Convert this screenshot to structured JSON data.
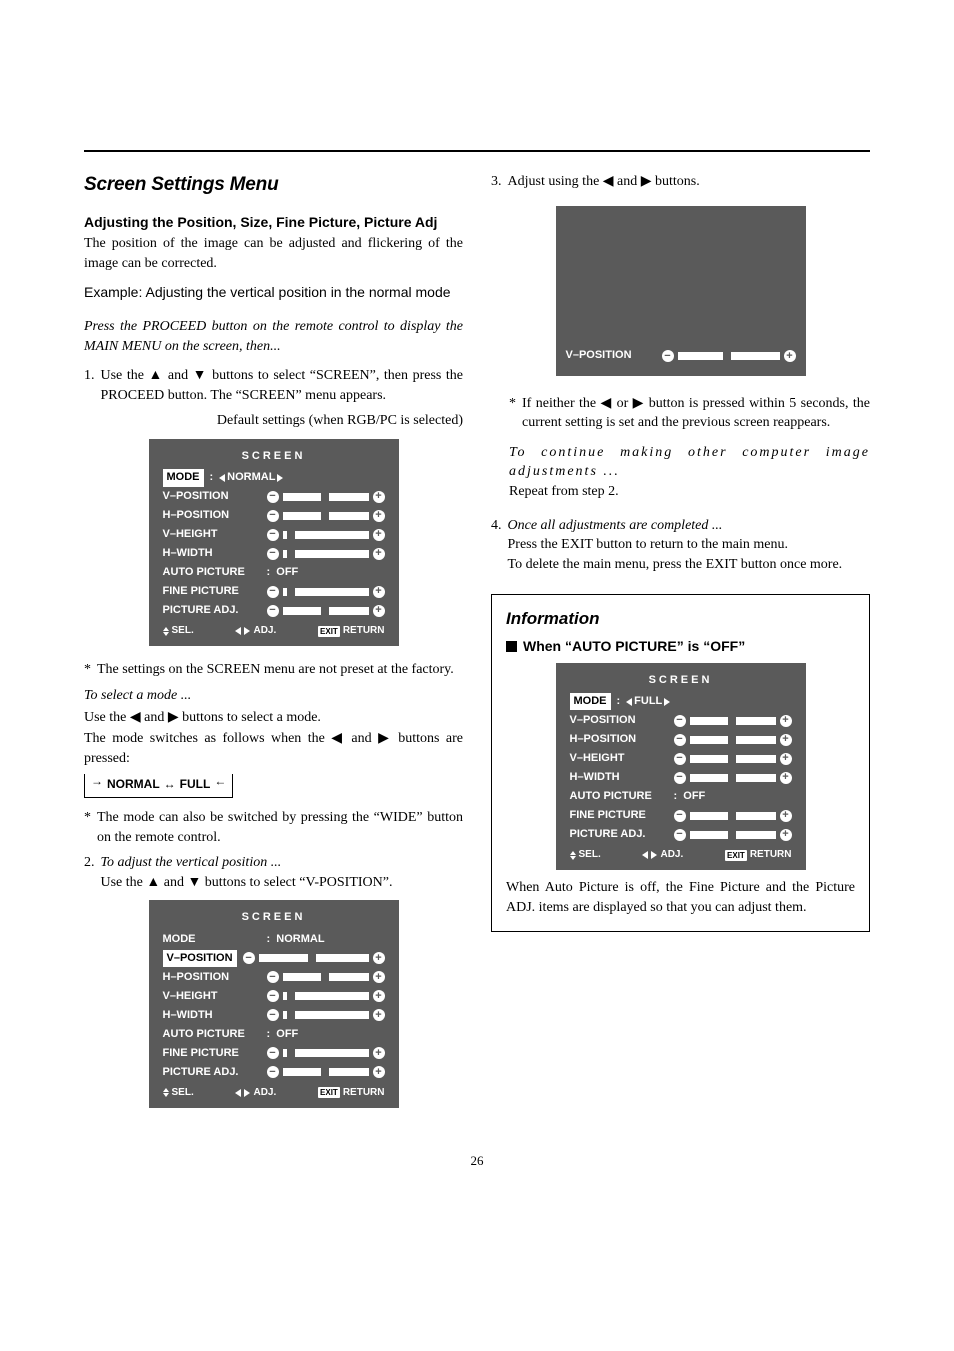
{
  "section_title": "Screen Settings Menu",
  "subhead": "Adjusting the Position, Size, Fine Picture, Picture Adj",
  "intro": "The position of the image can be adjusted and flickering of the image can be corrected.",
  "example": "Example: Adjusting the vertical position in the normal mode",
  "press_proceed": "Press the PROCEED button on the remote control to display the MAIN MENU on the screen, then...",
  "step1_num": "1.",
  "step1": "Use the ▲ and ▼ buttons to select “SCREEN”, then press the PROCEED button. The “SCREEN” menu appears.",
  "default_note": "Default settings (when RGB/PC is selected)",
  "osd": {
    "title": "SCREEN",
    "mode": "MODE",
    "mode_val_normal": "NORMAL",
    "mode_val_full": "FULL",
    "vpos": "V–POSITION",
    "hpos": "H–POSITION",
    "vheight": "V–HEIGHT",
    "hwidth": "H–WIDTH",
    "auto": "AUTO PICTURE",
    "off": "OFF",
    "fine": "FINE PICTURE",
    "padj": "PICTURE ADJ.",
    "sel": "SEL.",
    "adj": "ADJ.",
    "exit": "EXIT",
    "return": "RETURN"
  },
  "note_factory": "The settings on the SCREEN menu are not preset at the factory.",
  "to_select_mode": "To select a mode ...",
  "select_mode_1": "Use the ◀ and ▶ buttons to select a mode.",
  "select_mode_2": "The mode switches as follows when the ◀ and ▶ buttons are pressed:",
  "mode_switch_a": "NORMAL",
  "mode_switch_b": "FULL",
  "note_wide": "The mode can also be switched by pressing the “WIDE” button on the remote control.",
  "step2_num": "2.",
  "step2a": "To adjust the vertical position ...",
  "step2b": "Use the ▲ and ▼ buttons to select “V-POSITION”.",
  "step3_num": "3.",
  "step3": "Adjust using the ◀ and ▶ buttons.",
  "note_5sec": "If neither the ◀ or ▶ button is pressed within 5 seconds, the current setting is set and the previous screen reappears.",
  "continue_a": "To continue making other computer image adjustments ...",
  "continue_b": "Repeat from step 2.",
  "step4_num": "4.",
  "step4a": "Once all adjustments are completed ...",
  "step4b": "Press the EXIT button to return to the main menu.",
  "step4c": "To delete the main menu, press the EXIT button once more.",
  "info_title": "Information",
  "info_sub": "When “AUTO PICTURE” is “OFF”",
  "info_text": "When Auto Picture is off, the Fine Picture and the Picture ADJ. items are displayed so that you can adjust them.",
  "page_num": "26"
}
